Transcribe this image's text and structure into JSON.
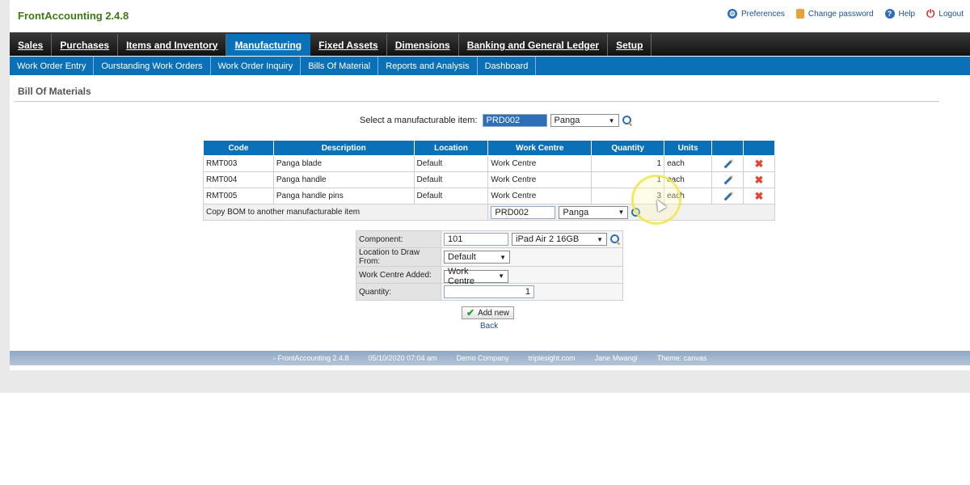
{
  "app": {
    "title": "FrontAccounting 2.4.8"
  },
  "toplinks": {
    "preferences": "Preferences",
    "change_password": "Change password",
    "help": "Help",
    "logout": "Logout"
  },
  "main_tabs": [
    {
      "label": "Sales"
    },
    {
      "label": "Purchases"
    },
    {
      "label": "Items and Inventory"
    },
    {
      "label": "Manufacturing"
    },
    {
      "label": "Fixed Assets"
    },
    {
      "label": "Dimensions"
    },
    {
      "label": "Banking and General Ledger"
    },
    {
      "label": "Setup"
    }
  ],
  "sub_tabs": [
    {
      "label": "Work Order Entry"
    },
    {
      "label": "Ourstanding Work Orders"
    },
    {
      "label": "Work Order Inquiry"
    },
    {
      "label": "Bills Of Material"
    },
    {
      "label": "Reports and Analysis"
    },
    {
      "label": "Dashboard"
    }
  ],
  "page": {
    "heading": "Bill Of Materials"
  },
  "select_item": {
    "label": "Select a manufacturable item:",
    "code": "PRD002",
    "name": "Panga"
  },
  "bom_table": {
    "headers": [
      "Code",
      "Description",
      "Location",
      "Work Centre",
      "Quantity",
      "Units"
    ],
    "rows": [
      {
        "code": "RMT003",
        "description": "Panga blade",
        "location": "Default",
        "work_centre": "Work Centre",
        "quantity": "1",
        "units": "each"
      },
      {
        "code": "RMT004",
        "description": "Panga handle",
        "location": "Default",
        "work_centre": "Work Centre",
        "quantity": "1",
        "units": "each"
      },
      {
        "code": "RMT005",
        "description": "Panga handle pins",
        "location": "Default",
        "work_centre": "Work Centre",
        "quantity": "3",
        "units": "each"
      }
    ],
    "copy": {
      "label": "Copy BOM to another manufacturable item",
      "code": "PRD002",
      "name": "Panga"
    }
  },
  "component_form": {
    "component_label": "Component:",
    "component_code": "101",
    "component_name": "iPad Air 2 16GB",
    "location_label": "Location to Draw From:",
    "location_value": "Default",
    "work_centre_label": "Work Centre Added:",
    "work_centre_value": "Work Centre",
    "quantity_label": "Quantity:",
    "quantity_value": "1"
  },
  "actions": {
    "add_new": "Add new",
    "back": "Back"
  },
  "footer": {
    "version": "FrontAccounting 2.4.8",
    "datetime": "05/10/2020 07:04 am",
    "company": "Demo Company",
    "site": "triplesight.com",
    "user": "Jane Mwangi",
    "theme": "Theme: canvas"
  }
}
